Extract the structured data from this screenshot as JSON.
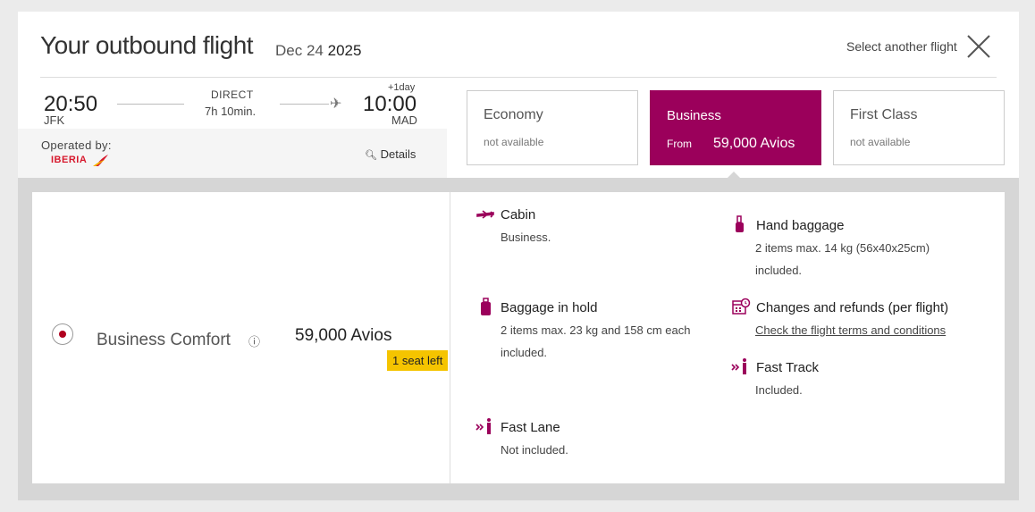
{
  "header": {
    "title": "Your outbound flight",
    "date_month_day": "Dec 24",
    "date_year": "2025",
    "select_another": "Select another flight"
  },
  "flight": {
    "departure_time": "20:50",
    "departure_code": "JFK",
    "arrival_time": "10:00",
    "arrival_code": "MAD",
    "arrival_offset": "+1day",
    "type": "DIRECT",
    "duration": "7h 10min.",
    "operated_by_label": "Operated by:",
    "airline": "IBERIA",
    "details_label": "Details"
  },
  "tabs": {
    "economy": {
      "name": "Economy",
      "status": "not available"
    },
    "business": {
      "name": "Business",
      "from_label": "From",
      "price": "59,000 Avios"
    },
    "first": {
      "name": "First Class",
      "status": "not available"
    }
  },
  "fare": {
    "name": "Business Comfort",
    "price": "59,000 Avios",
    "seats_left": "1 seat left"
  },
  "features": {
    "cabin": {
      "title": "Cabin",
      "sub": "Business."
    },
    "hand_baggage": {
      "title": "Hand baggage",
      "sub1": "2 items max. 14 kg (56x40x25cm)",
      "sub2": "included."
    },
    "hold": {
      "title": "Baggage in hold",
      "sub1": "2 items max. 23 kg and 158 cm each",
      "sub2": "included."
    },
    "changes": {
      "title": "Changes and refunds (per flight)",
      "link": "Check the flight terms and conditions"
    },
    "fast_track": {
      "title": "Fast Track",
      "sub": "Included."
    },
    "fast_lane": {
      "title": "Fast Lane",
      "sub": "Not included."
    }
  },
  "colors": {
    "brand": "#9b005b",
    "badge": "#f5c400",
    "radio": "#b0001e"
  }
}
